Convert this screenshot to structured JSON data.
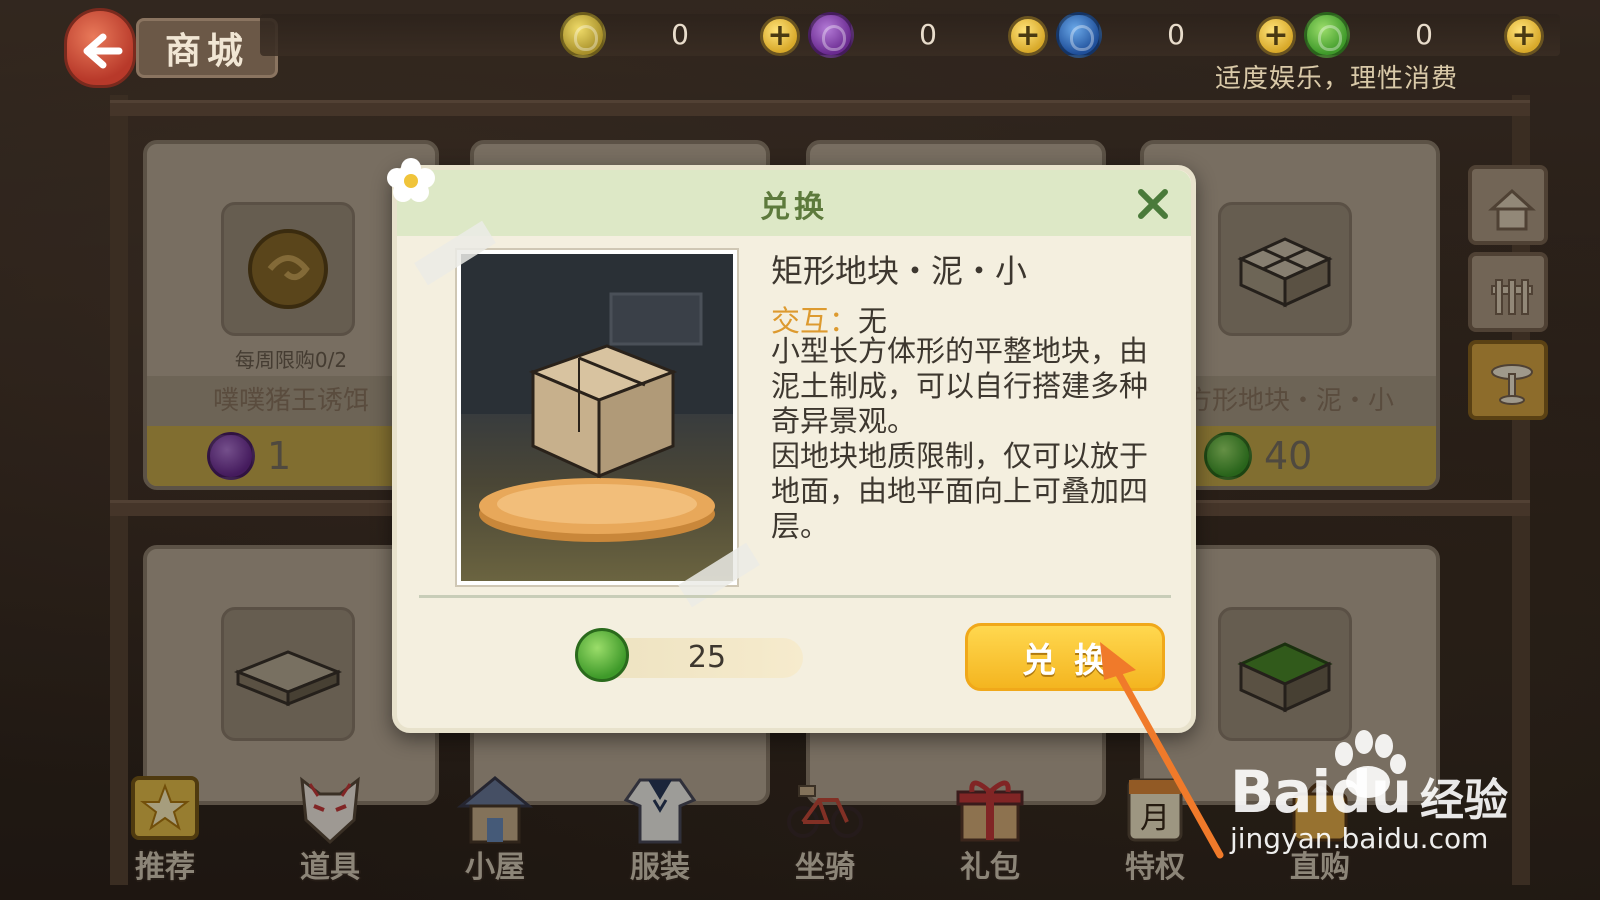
{
  "header": {
    "title": "商城",
    "notice": "适度娱乐，理性消费"
  },
  "currencies": [
    {
      "icon": "yellow-leaf-coin-icon",
      "color": "#c9b340",
      "value": "0"
    },
    {
      "icon": "purple-cabbage-coin-icon",
      "color": "#8a3fb0",
      "value": "0"
    },
    {
      "icon": "blue-cabbage-coin-icon",
      "color": "#2f6fb8",
      "value": "0"
    },
    {
      "icon": "green-cabbage-coin-icon",
      "color": "#4a9e38",
      "value": "0"
    }
  ],
  "shop_items": [
    {
      "limit": "每周限购0/2",
      "name": "噗噗猪王诱饵",
      "price": "1",
      "coin_color": "#8a3fb0"
    },
    {
      "name": "方形地块・泥・小",
      "price": "40",
      "coin_color": "#4a9e38"
    }
  ],
  "side_tabs": [
    "house-tab-icon",
    "fence-tab-icon",
    "table-tab-icon"
  ],
  "bottom_nav": [
    {
      "label": "推荐",
      "icon": "star-icon"
    },
    {
      "label": "道具",
      "icon": "fox-mask-icon"
    },
    {
      "label": "小屋",
      "icon": "house-icon"
    },
    {
      "label": "服装",
      "icon": "sailor-uniform-icon"
    },
    {
      "label": "坐骑",
      "icon": "bicycle-icon"
    },
    {
      "label": "礼包",
      "icon": "gift-box-icon"
    },
    {
      "label": "特权",
      "icon": "month-card-icon"
    },
    {
      "label": "直购",
      "icon": "purchase-bag-icon"
    }
  ],
  "modal": {
    "title": "兑换",
    "item_title": "矩形地块・泥・小",
    "interaction_label": "交互：",
    "interaction_value": "无",
    "desc_lines": [
      "小型长方体形的平整地块，由泥土制成，可以自行搭建多种奇异景观。",
      "因地块地质限制，仅可以放于地面，由地平面向上可叠加四层。"
    ],
    "cost": "25",
    "cost_coin_color": "#4a9e38",
    "button_label": "兑换"
  },
  "watermark": {
    "brand": "Baidu",
    "suffix": "经验",
    "url": "jingyan.baidu.com"
  }
}
